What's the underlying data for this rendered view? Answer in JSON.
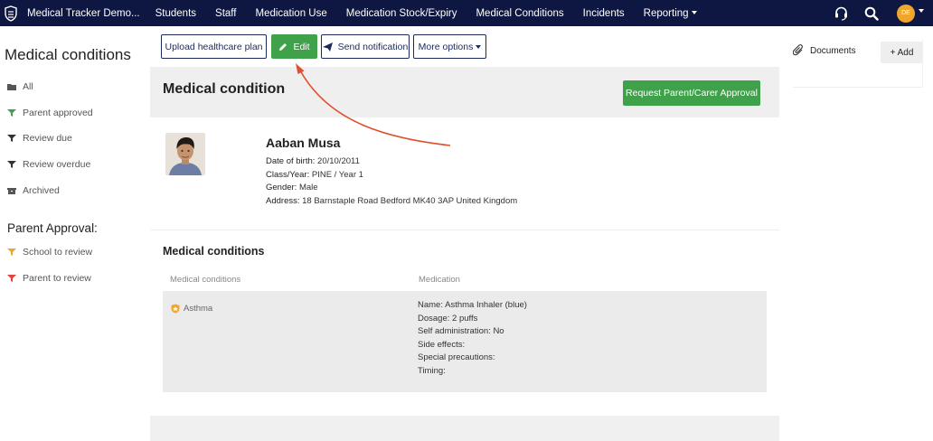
{
  "navbar": {
    "brand": "Medical Tracker Demo...",
    "items": [
      {
        "label": "Students"
      },
      {
        "label": "Staff"
      },
      {
        "label": "Medication Use"
      },
      {
        "label": "Medication Stock/Expiry"
      },
      {
        "label": "Medical Conditions"
      },
      {
        "label": "Incidents"
      },
      {
        "label": "Reporting"
      }
    ],
    "avatar_initials": "DE"
  },
  "sidebar": {
    "title": "Medical conditions",
    "items": [
      {
        "label": "All",
        "icon": "folder-icon"
      },
      {
        "label": "Parent approved",
        "icon": "filter-icon",
        "color": "#3fa24b"
      },
      {
        "label": "Review due",
        "icon": "filter-icon",
        "color": "#333333"
      },
      {
        "label": "Review overdue",
        "icon": "filter-icon",
        "color": "#333333"
      },
      {
        "label": "Archived",
        "icon": "archive-icon"
      }
    ],
    "approval_title": "Parent Approval:",
    "approval_items": [
      {
        "label": "School to review",
        "icon": "filter-icon",
        "color": "#f0a62c"
      },
      {
        "label": "Parent to review",
        "icon": "filter-icon",
        "color": "#e0433a"
      }
    ]
  },
  "actions": {
    "upload": "Upload healthcare plan",
    "edit": "Edit",
    "send": "Send notification",
    "more": "More options"
  },
  "card": {
    "title": "Medical condition",
    "approve_button": "Request Parent/Carer Approval",
    "student": {
      "name": "Aaban Musa",
      "dob_label": "Date of birth:",
      "dob": "20/10/2011",
      "class_label": "Class/Year:",
      "class": "PINE / Year 1",
      "gender_label": "Gender:",
      "gender": "Male",
      "address_label": "Address:",
      "address": "18 Barnstaple Road Bedford MK40 3AP United Kingdom"
    },
    "conditions": {
      "title": "Medical conditions",
      "col_condition": "Medical conditions",
      "col_medication": "Medication",
      "rows": [
        {
          "condition": "Asthma",
          "name_label": "Name:",
          "name": "Asthma Inhaler (blue)",
          "dosage_label": "Dosage:",
          "dosage": "2 puffs",
          "self_label": "Self administration:",
          "self": "No",
          "side_label": "Side effects:",
          "precautions_label": "Special precautions:",
          "timing_label": "Timing:"
        }
      ]
    }
  },
  "documents": {
    "title": "Documents",
    "add": "+ Add"
  },
  "colors": {
    "navbar": "#0d1742",
    "green": "#3fa24b",
    "annotation_arrow": "#e0502e",
    "avatar": "#f0a62c"
  }
}
